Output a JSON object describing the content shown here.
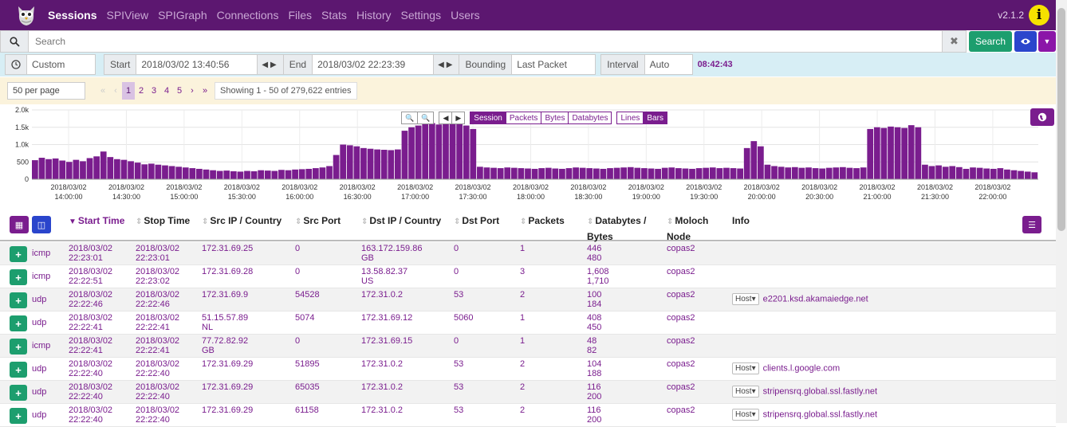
{
  "nav": {
    "items": [
      "Sessions",
      "SPIView",
      "SPIGraph",
      "Connections",
      "Files",
      "Stats",
      "History",
      "Settings",
      "Users"
    ],
    "active": "Sessions",
    "version": "v2.1.2"
  },
  "search": {
    "placeholder": "Search",
    "button": "Search"
  },
  "time": {
    "range": "Custom",
    "start_label": "Start",
    "start_value": "2018/03/02 13:40:56",
    "end_label": "End",
    "end_value": "2018/03/02 22:23:39",
    "bounding_label": "Bounding",
    "bounding_value": "Last Packet",
    "interval_label": "Interval",
    "interval_value": "Auto",
    "elapsed": "08:42:43"
  },
  "paging": {
    "per_page": "50 per page",
    "pages": [
      "1",
      "2",
      "3",
      "4",
      "5"
    ],
    "active_page": "1",
    "showing": "Showing 1 - 50 of 279,622 entries"
  },
  "graph": {
    "types": [
      "Session",
      "Packets",
      "Bytes",
      "Databytes"
    ],
    "active_type": "Session",
    "styles": [
      "Lines",
      "Bars"
    ],
    "active_style": "Bars"
  },
  "chart_data": {
    "type": "bar",
    "ylim": [
      0,
      2000
    ],
    "y_ticks": [
      "2.0k",
      "1.5k",
      "1.0k",
      "500",
      "0"
    ],
    "x_ticks": [
      {
        "date": "2018/03/02",
        "time": "14:00:00"
      },
      {
        "date": "2018/03/02",
        "time": "14:30:00"
      },
      {
        "date": "2018/03/02",
        "time": "15:00:00"
      },
      {
        "date": "2018/03/02",
        "time": "15:30:00"
      },
      {
        "date": "2018/03/02",
        "time": "16:00:00"
      },
      {
        "date": "2018/03/02",
        "time": "16:30:00"
      },
      {
        "date": "2018/03/02",
        "time": "17:00:00"
      },
      {
        "date": "2018/03/02",
        "time": "17:30:00"
      },
      {
        "date": "2018/03/02",
        "time": "18:00:00"
      },
      {
        "date": "2018/03/02",
        "time": "18:30:00"
      },
      {
        "date": "2018/03/02",
        "time": "19:00:00"
      },
      {
        "date": "2018/03/02",
        "time": "19:30:00"
      },
      {
        "date": "2018/03/02",
        "time": "20:00:00"
      },
      {
        "date": "2018/03/02",
        "time": "20:30:00"
      },
      {
        "date": "2018/03/02",
        "time": "21:00:00"
      },
      {
        "date": "2018/03/02",
        "time": "21:30:00"
      },
      {
        "date": "2018/03/02",
        "time": "22:00:00"
      }
    ],
    "x_start": "2018/03/02 13:40:56",
    "x_end": "2018/03/02 22:23:39",
    "values": [
      550,
      620,
      580,
      600,
      540,
      500,
      560,
      520,
      610,
      660,
      800,
      640,
      580,
      560,
      520,
      480,
      430,
      450,
      420,
      400,
      380,
      360,
      340,
      320,
      300,
      280,
      260,
      240,
      250,
      230,
      220,
      240,
      230,
      260,
      250,
      240,
      270,
      260,
      280,
      290,
      300,
      320,
      340,
      380,
      700,
      1000,
      980,
      950,
      900,
      880,
      860,
      850,
      840,
      860,
      1400,
      1500,
      1550,
      1600,
      1620,
      1580,
      1600,
      1650,
      1600,
      1550,
      1450,
      360,
      340,
      330,
      320,
      340,
      330,
      320,
      310,
      300,
      320,
      330,
      310,
      300,
      320,
      340,
      330,
      320,
      310,
      300,
      320,
      330,
      340,
      350,
      330,
      320,
      310,
      300,
      330,
      340,
      320,
      310,
      300,
      320,
      330,
      340,
      320,
      330,
      320,
      310,
      900,
      1100,
      950,
      420,
      380,
      360,
      340,
      350,
      330,
      340,
      320,
      310,
      330,
      340,
      350,
      330,
      320,
      340,
      1450,
      1500,
      1480,
      1520,
      1500,
      1480,
      1560,
      1500,
      420,
      380,
      400,
      360,
      380,
      350,
      300,
      340,
      330,
      310,
      300,
      320,
      280,
      260,
      240,
      220,
      200
    ]
  },
  "table": {
    "headers": [
      "Start Time",
      "Stop Time",
      "Src IP / Country",
      "Src Port",
      "Dst IP / Country",
      "Dst Port",
      "Packets",
      "Databytes / Bytes",
      "Moloch Node",
      "Info"
    ],
    "rows": [
      {
        "proto": "icmp",
        "start": [
          "2018/03/02",
          "22:23:01"
        ],
        "stop": [
          "2018/03/02",
          "22:23:01"
        ],
        "src": [
          "172.31.69.25",
          ""
        ],
        "sport": "0",
        "dst": [
          "163.172.159.86",
          "GB"
        ],
        "dport": "0",
        "packets": "1",
        "bytes": [
          "446",
          "480"
        ],
        "node": "copas2",
        "info_label": "",
        "info": ""
      },
      {
        "proto": "icmp",
        "start": [
          "2018/03/02",
          "22:22:51"
        ],
        "stop": [
          "2018/03/02",
          "22:23:02"
        ],
        "src": [
          "172.31.69.28",
          ""
        ],
        "sport": "0",
        "dst": [
          "13.58.82.37",
          "US"
        ],
        "dport": "0",
        "packets": "3",
        "bytes": [
          "1,608",
          "1,710"
        ],
        "node": "copas2",
        "info_label": "",
        "info": ""
      },
      {
        "proto": "udp",
        "start": [
          "2018/03/02",
          "22:22:46"
        ],
        "stop": [
          "2018/03/02",
          "22:22:46"
        ],
        "src": [
          "172.31.69.9",
          ""
        ],
        "sport": "54528",
        "dst": [
          "172.31.0.2",
          ""
        ],
        "dport": "53",
        "packets": "2",
        "bytes": [
          "100",
          "184"
        ],
        "node": "copas2",
        "info_label": "Host",
        "info": "e2201.ksd.akamaiedge.net"
      },
      {
        "proto": "udp",
        "start": [
          "2018/03/02",
          "22:22:41"
        ],
        "stop": [
          "2018/03/02",
          "22:22:41"
        ],
        "src": [
          "51.15.57.89",
          "NL"
        ],
        "sport": "5074",
        "dst": [
          "172.31.69.12",
          ""
        ],
        "dport": "5060",
        "packets": "1",
        "bytes": [
          "408",
          "450"
        ],
        "node": "copas2",
        "info_label": "",
        "info": ""
      },
      {
        "proto": "icmp",
        "start": [
          "2018/03/02",
          "22:22:41"
        ],
        "stop": [
          "2018/03/02",
          "22:22:41"
        ],
        "src": [
          "77.72.82.92",
          "GB"
        ],
        "sport": "0",
        "dst": [
          "172.31.69.15",
          ""
        ],
        "dport": "0",
        "packets": "1",
        "bytes": [
          "48",
          "82"
        ],
        "node": "copas2",
        "info_label": "",
        "info": ""
      },
      {
        "proto": "udp",
        "start": [
          "2018/03/02",
          "22:22:40"
        ],
        "stop": [
          "2018/03/02",
          "22:22:40"
        ],
        "src": [
          "172.31.69.29",
          ""
        ],
        "sport": "51895",
        "dst": [
          "172.31.0.2",
          ""
        ],
        "dport": "53",
        "packets": "2",
        "bytes": [
          "104",
          "188"
        ],
        "node": "copas2",
        "info_label": "Host",
        "info": "clients.l.google.com"
      },
      {
        "proto": "udp",
        "start": [
          "2018/03/02",
          "22:22:40"
        ],
        "stop": [
          "2018/03/02",
          "22:22:40"
        ],
        "src": [
          "172.31.69.29",
          ""
        ],
        "sport": "65035",
        "dst": [
          "172.31.0.2",
          ""
        ],
        "dport": "53",
        "packets": "2",
        "bytes": [
          "116",
          "200"
        ],
        "node": "copas2",
        "info_label": "Host",
        "info": "stripensrq.global.ssl.fastly.net"
      },
      {
        "proto": "udp",
        "start": [
          "2018/03/02",
          "22:22:40"
        ],
        "stop": [
          "2018/03/02",
          "22:22:40"
        ],
        "src": [
          "172.31.69.29",
          ""
        ],
        "sport": "61158",
        "dst": [
          "172.31.0.2",
          ""
        ],
        "dport": "53",
        "packets": "2",
        "bytes": [
          "116",
          "200"
        ],
        "node": "copas2",
        "info_label": "Host",
        "info": "stripensrq.global.ssl.fastly.net"
      }
    ]
  },
  "colors": {
    "nav_bg": "#5c1770",
    "accent": "#7a1d8e",
    "success": "#1d9e6e",
    "primary": "#2a45cc",
    "info_badge": "#f6e100"
  }
}
